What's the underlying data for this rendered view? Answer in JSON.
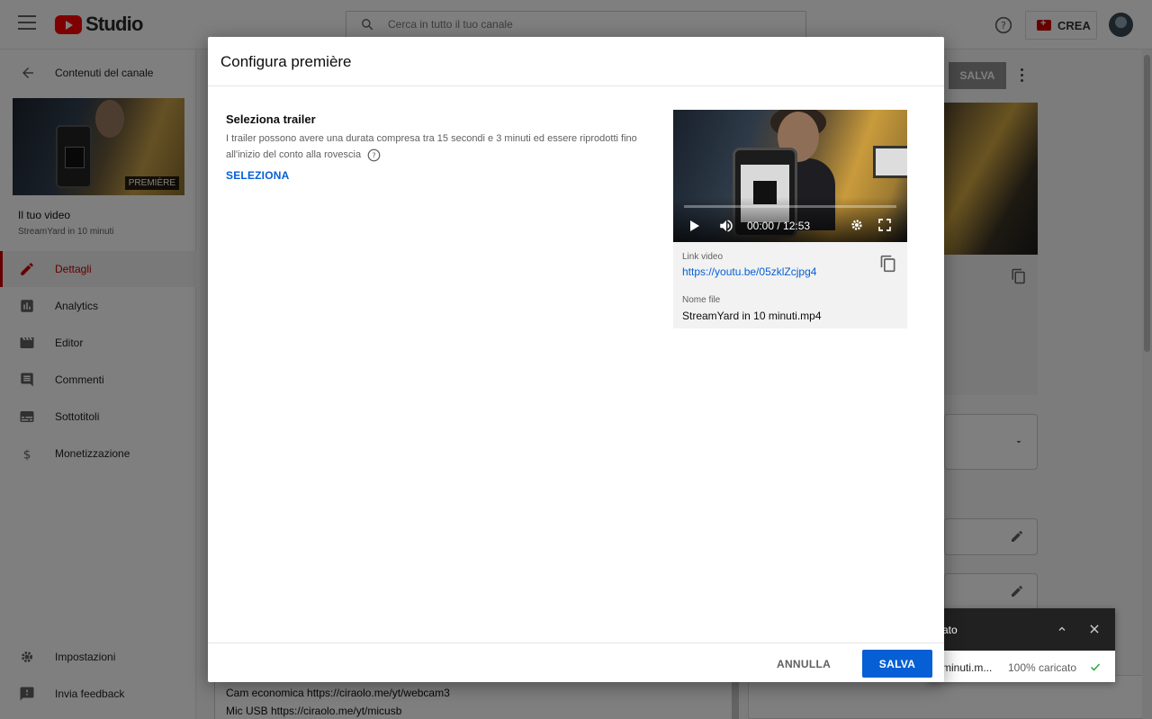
{
  "app": {
    "logo_text": "Studio",
    "brand_color": "#ff0000",
    "accent_color": "#065fd4"
  },
  "header": {
    "search_placeholder": "Cerca in tutto il tuo canale",
    "create_label": "CREA"
  },
  "sidebar": {
    "back_label": "Contenuti del canale",
    "thumbnail_badge": "PREMIÈRE",
    "video_title": "Il tuo video",
    "video_subtitle": "StreamYard in 10 minuti",
    "nav": [
      {
        "label": "Dettagli",
        "icon": "pencil-icon",
        "active": true
      },
      {
        "label": "Analytics",
        "icon": "analytics-icon"
      },
      {
        "label": "Editor",
        "icon": "editor-icon"
      },
      {
        "label": "Commenti",
        "icon": "comments-icon"
      },
      {
        "label": "Sottotitoli",
        "icon": "subtitles-icon"
      },
      {
        "label": "Monetizzazione",
        "icon": "dollar-icon"
      }
    ],
    "footer": [
      {
        "label": "Impostazioni",
        "icon": "gear-icon"
      },
      {
        "label": "Invia feedback",
        "icon": "feedback-icon"
      }
    ]
  },
  "background_page": {
    "save_label": "SALVA",
    "description_lines": [
      "Cam economica https://ciraolo.me/yt/webcam3",
      "Mic USB https://ciraolo.me/yt/micusb"
    ]
  },
  "upload_toast": {
    "title": "ato",
    "file": "minuti.m...",
    "status": "100% caricato"
  },
  "dialog": {
    "title": "Configura première",
    "section_title": "Seleziona trailer",
    "section_description": "I trailer possono avere una durata compresa tra 15 secondi e 3 minuti ed essere riprodotti fino all'inizio del conto alla rovescia",
    "select_label": "SELEZIONA",
    "player_time": "00:00 / 12:53",
    "link_label": "Link video",
    "link_value": "https://youtu.be/05zklZcjpg4",
    "file_label": "Nome file",
    "file_value": "StreamYard in 10 minuti.mp4",
    "cancel_label": "ANNULLA",
    "save_label": "SALVA"
  }
}
